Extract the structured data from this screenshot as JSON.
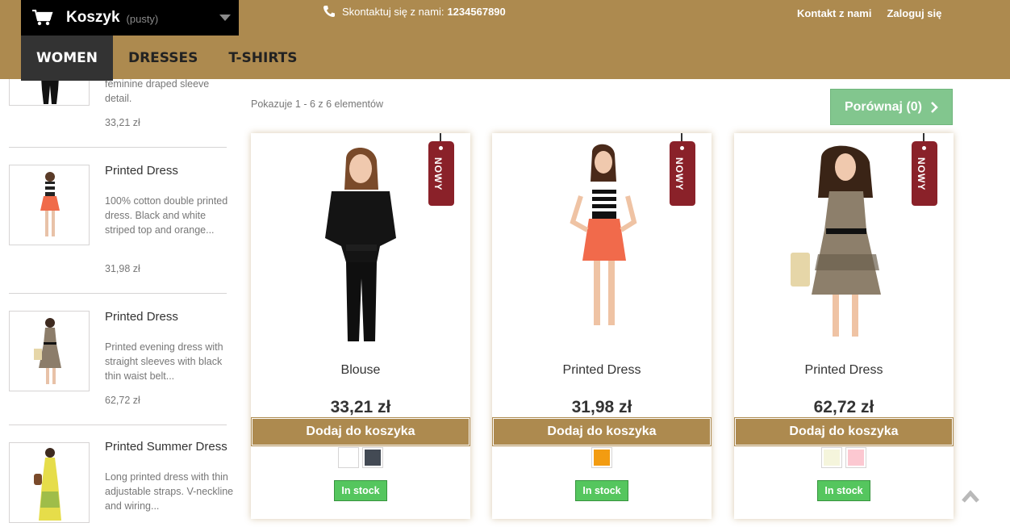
{
  "header": {
    "cart": {
      "label": "Koszyk",
      "status": "(pusty)"
    },
    "contact": {
      "label": "Skontaktuj się z nami:",
      "phone": "1234567890"
    },
    "links": [
      "Kontakt z nami",
      "Zaloguj się"
    ],
    "nav": [
      "WOMEN",
      "DRESSES",
      "T-SHIRTS"
    ],
    "active_nav": "WOMEN"
  },
  "sidebar": {
    "items": [
      {
        "name": "",
        "desc": "feminine draped sleeve detail.",
        "price": "33,21 zł"
      },
      {
        "name": "Printed Dress",
        "desc": "100% cotton double printed dress. Black and white striped top and orange...",
        "price": "31,98 zł"
      },
      {
        "name": "Printed Dress",
        "desc": "Printed evening dress with straight sleeves with black thin waist belt...",
        "price": "62,72 zł"
      },
      {
        "name": "Printed Summer Dress",
        "desc": "Long printed dress with thin adjustable straps. V-neckline and wiring...",
        "price": ""
      }
    ]
  },
  "main": {
    "showing": "Pokazuje 1 - 6 z 6 elementów",
    "compare": "Porównaj (0)",
    "products": [
      {
        "name": "Blouse",
        "price": "33,21 zł",
        "tag": "NOWY",
        "add": "Dodaj do koszyka",
        "stock": "In stock",
        "colors": [
          "#ffffff",
          "#434a54"
        ]
      },
      {
        "name": "Printed Dress",
        "price": "31,98 zł",
        "tag": "NOWY",
        "add": "Dodaj do koszyka",
        "stock": "In stock",
        "colors": [
          "#f39c11"
        ]
      },
      {
        "name": "Printed Dress",
        "price": "62,72 zł",
        "tag": "NOWY",
        "add": "Dodaj do koszyka",
        "stock": "In stock",
        "colors": [
          "#f5f5dc",
          "#fcc8d1"
        ]
      }
    ]
  },
  "colors": {
    "brand": "#ad8a4f",
    "tag": "#8a2129",
    "stock": "#55c65e",
    "compare": "#82c68e"
  },
  "icons": [
    "cart-icon",
    "phone-icon",
    "chevron-right-icon",
    "scroll-top-icon"
  ]
}
